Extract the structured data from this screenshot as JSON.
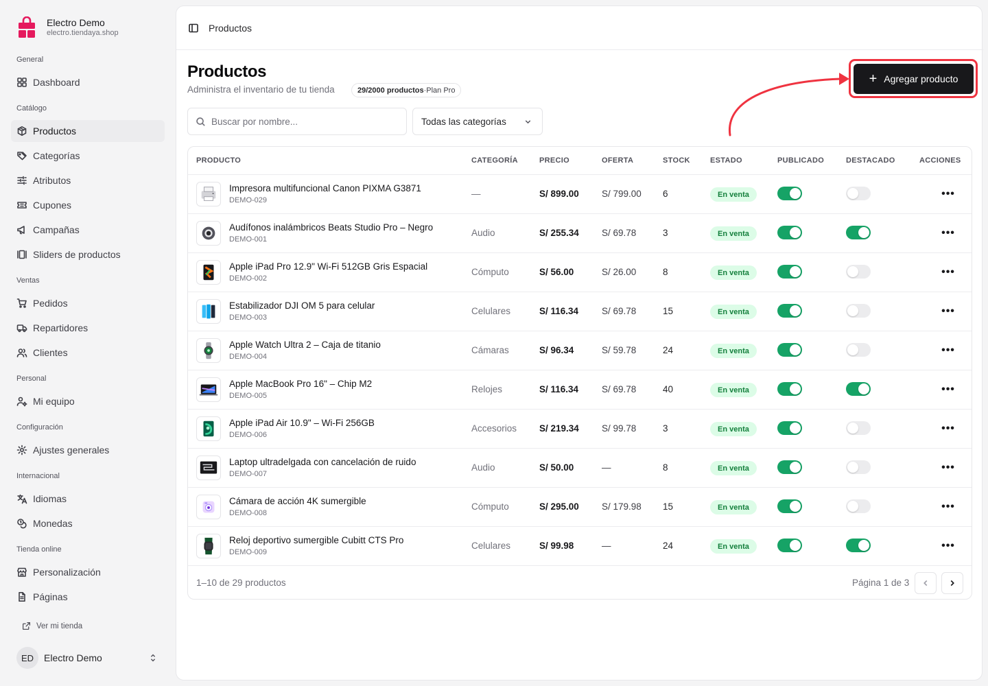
{
  "store": {
    "name": "Electro Demo",
    "domain": "electro.tiendaya.shop",
    "icon": "shopping-bag-logo-icon",
    "brand_color": "#e5195d"
  },
  "nav": [
    {
      "section": "General",
      "items": [
        {
          "label": "Dashboard",
          "icon": "dashboard-icon"
        }
      ]
    },
    {
      "section": "Catálogo",
      "items": [
        {
          "label": "Productos",
          "icon": "box-icon",
          "active": true
        },
        {
          "label": "Categorías",
          "icon": "tags-icon"
        },
        {
          "label": "Atributos",
          "icon": "sliders-icon"
        },
        {
          "label": "Cupones",
          "icon": "ticket-icon"
        },
        {
          "label": "Campañas",
          "icon": "megaphone-icon"
        },
        {
          "label": "Sliders de productos",
          "icon": "gallery-icon"
        }
      ]
    },
    {
      "section": "Ventas",
      "items": [
        {
          "label": "Pedidos",
          "icon": "cart-icon"
        },
        {
          "label": "Repartidores",
          "icon": "truck-icon"
        },
        {
          "label": "Clientes",
          "icon": "users-icon"
        }
      ]
    },
    {
      "section": "Personal",
      "items": [
        {
          "label": "Mi equipo",
          "icon": "user-cog-icon"
        }
      ]
    },
    {
      "section": "Configuración",
      "items": [
        {
          "label": "Ajustes generales",
          "icon": "gear-icon"
        }
      ]
    },
    {
      "section": "Internacional",
      "items": [
        {
          "label": "Idiomas",
          "icon": "languages-icon"
        },
        {
          "label": "Monedas",
          "icon": "coins-icon"
        }
      ]
    },
    {
      "section": "Tienda online",
      "items": [
        {
          "label": "Personalización",
          "icon": "store-icon"
        },
        {
          "label": "Páginas",
          "icon": "file-icon"
        }
      ]
    }
  ],
  "view_store": "Ver mi tienda",
  "user": {
    "initials": "ED",
    "name": "Electro Demo"
  },
  "topbar": {
    "title": "Productos"
  },
  "page": {
    "title": "Productos",
    "subtitle": "Administra el inventario de tu tienda",
    "plan_badge": {
      "count": "29/2000 productos",
      "separator": " · ",
      "plan": "Plan Pro"
    },
    "add_button": "Agregar producto"
  },
  "filters": {
    "search_placeholder": "Buscar por nombre...",
    "category_value": "Todas las categorías"
  },
  "table": {
    "headers": [
      "PRODUCTO",
      "CATEGORÍA",
      "PRECIO",
      "OFERTA",
      "STOCK",
      "ESTADO",
      "PUBLICADO",
      "DESTACADO",
      "ACCIONES"
    ],
    "rows": [
      {
        "name": "Impresora multifuncional Canon PIXMA G3871",
        "sku": "DEMO-029",
        "category": "—",
        "price": "S/ 899.00",
        "offer": "S/ 799.00",
        "stock": "6",
        "status": "En venta",
        "published": true,
        "featured": false,
        "thumb": "printer"
      },
      {
        "name": "Audífonos inalámbricos Beats Studio Pro – Negro",
        "sku": "DEMO-001",
        "category": "Audio",
        "price": "S/ 255.34",
        "offer": "S/ 69.78",
        "stock": "3",
        "status": "En venta",
        "published": true,
        "featured": true,
        "thumb": "headphones"
      },
      {
        "name": "Apple iPad Pro 12.9\" Wi-Fi 512GB Gris Espacial",
        "sku": "DEMO-002",
        "category": "Cómputo",
        "price": "S/ 56.00",
        "offer": "S/ 26.00",
        "stock": "8",
        "status": "En venta",
        "published": true,
        "featured": false,
        "thumb": "ipad-pro"
      },
      {
        "name": "Estabilizador DJI OM 5 para celular",
        "sku": "DEMO-003",
        "category": "Celulares",
        "price": "S/ 116.34",
        "offer": "S/ 69.78",
        "stock": "15",
        "status": "En venta",
        "published": true,
        "featured": false,
        "thumb": "phones"
      },
      {
        "name": "Apple Watch Ultra 2 – Caja de titanio",
        "sku": "DEMO-004",
        "category": "Cámaras",
        "price": "S/ 96.34",
        "offer": "S/ 59.78",
        "stock": "24",
        "status": "En venta",
        "published": true,
        "featured": false,
        "thumb": "watch"
      },
      {
        "name": "Apple MacBook Pro 16\" – Chip M2",
        "sku": "DEMO-005",
        "category": "Relojes",
        "price": "S/ 116.34",
        "offer": "S/ 69.78",
        "stock": "40",
        "status": "En venta",
        "published": true,
        "featured": true,
        "thumb": "macbook"
      },
      {
        "name": "Apple iPad Air 10.9\" – Wi-Fi 256GB",
        "sku": "DEMO-006",
        "category": "Accesorios",
        "price": "S/ 219.34",
        "offer": "S/ 99.78",
        "stock": "3",
        "status": "En venta",
        "published": true,
        "featured": false,
        "thumb": "ipad-air"
      },
      {
        "name": "Laptop ultradelgada con cancelación de ruido",
        "sku": "DEMO-007",
        "category": "Audio",
        "price": "S/ 50.00",
        "offer": "—",
        "stock": "8",
        "status": "En venta",
        "published": true,
        "featured": false,
        "thumb": "laptop"
      },
      {
        "name": "Cámara de acción 4K sumergible",
        "sku": "DEMO-008",
        "category": "Cómputo",
        "price": "S/ 295.00",
        "offer": "S/ 179.98",
        "stock": "15",
        "status": "En venta",
        "published": true,
        "featured": false,
        "thumb": "camera"
      },
      {
        "name": "Reloj deportivo sumergible Cubitt CTS Pro",
        "sku": "DEMO-009",
        "category": "Celulares",
        "price": "S/ 99.98",
        "offer": "—",
        "stock": "24",
        "status": "En venta",
        "published": true,
        "featured": true,
        "thumb": "sport-watch"
      }
    ]
  },
  "footer": {
    "count": "1–10 de 29 productos",
    "page_info": "Página 1 de 3"
  },
  "colors": {
    "accent": "#18181b",
    "success": "#16a366",
    "badge_bg": "#dcfce7",
    "badge_text": "#15803d",
    "highlight": "#ef3340"
  }
}
